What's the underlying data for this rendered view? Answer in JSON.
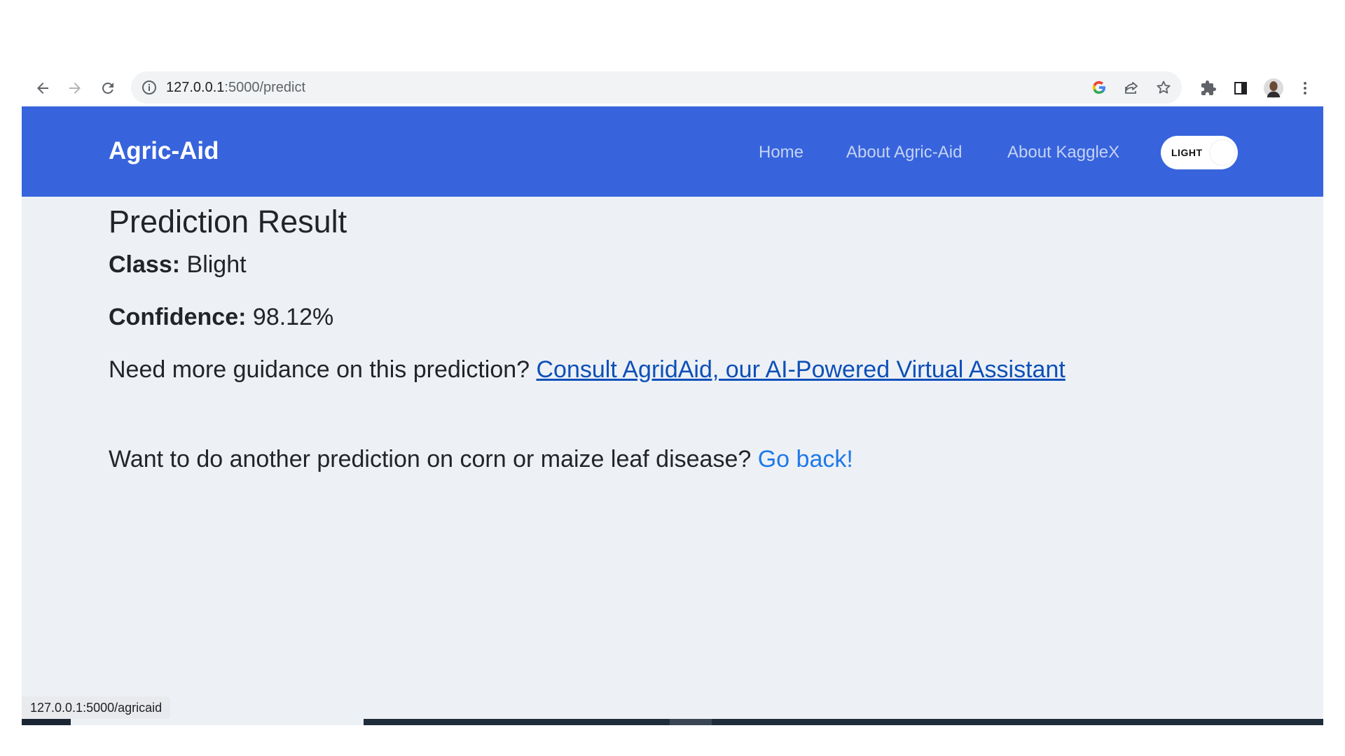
{
  "browser": {
    "url_host": "127.0.0.1",
    "url_path": ":5000/predict",
    "icons": {
      "back": "arrow-left-icon",
      "forward": "arrow-right-icon",
      "reload": "reload-icon",
      "site_info": "info-icon",
      "google_lens": "google-g-icon",
      "share": "share-icon",
      "bookmark": "star-icon",
      "extensions": "puzzle-icon",
      "side_panel": "side-panel-icon",
      "profile": "profile-avatar",
      "menu": "kebab-menu-icon"
    }
  },
  "navbar": {
    "brand": "Agric-Aid",
    "links": [
      "Home",
      "About Agric-Aid",
      "About KaggleX"
    ],
    "theme_toggle_label": "LIGHT",
    "bg_color": "#3764dc"
  },
  "result": {
    "title": "Prediction Result",
    "class_label": "Class:",
    "class_value": "Blight",
    "confidence_label": "Confidence:",
    "confidence_value": "98.12%",
    "guidance_text": "Need more guidance on this prediction?",
    "consult_link": "Consult AgridAid, our AI-Powered Virtual Assistant",
    "goback_text": "Want to do another prediction on corn or maize leaf disease?",
    "goback_link": "Go back!"
  },
  "status_bar": {
    "hover_url": "127.0.0.1:5000/agricaid"
  }
}
